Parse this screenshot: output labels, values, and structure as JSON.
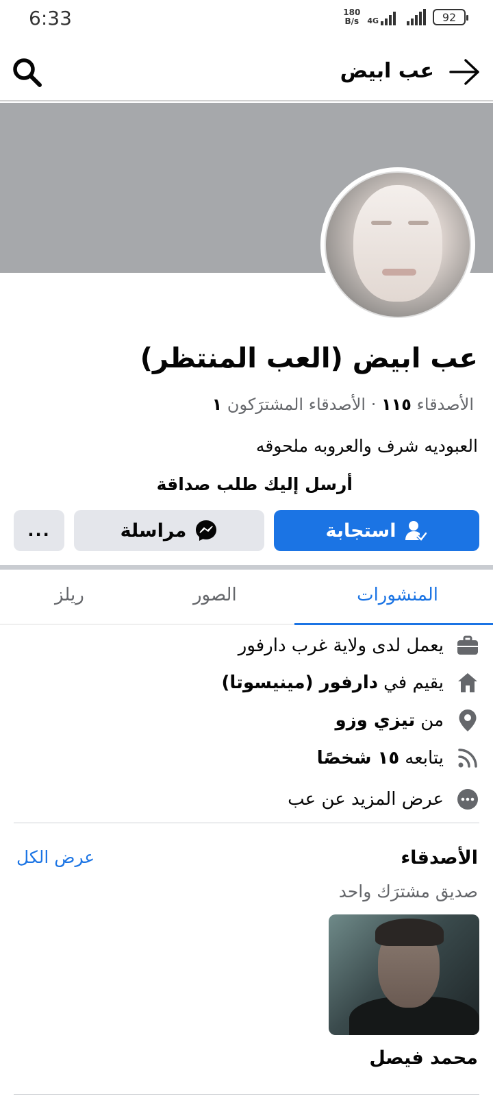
{
  "status_bar": {
    "time": "6:33",
    "net_speed_value": "180",
    "net_speed_unit": "B/s",
    "net_type": "4G",
    "battery": "92"
  },
  "header": {
    "title": "عب ابيض"
  },
  "profile": {
    "name": "عب ابيض (العب المنتظر)",
    "friends_label": "الأصدقاء",
    "friends_count": "١١٥",
    "mutual_label": "الأصدقاء المشترَكون",
    "mutual_count": "١",
    "bio": "العبوديه شرف والعروبه ملحوقه",
    "request_text": "أرسل إليك طلب صداقة"
  },
  "actions": {
    "respond": "استجابة",
    "message": "مراسلة",
    "more": "..."
  },
  "tabs": {
    "posts": "المنشورات",
    "photos": "الصور",
    "reels": "ريلز"
  },
  "details": {
    "work": "يعمل لدى ولاية غرب دارفور",
    "lives_prefix": "يقيم في",
    "lives_place": "دارفور (مينيسوتا)",
    "from_prefix": "من",
    "from_place": "تيزي وزو",
    "followed_prefix": "يتابعه",
    "followed_count": "١٥ شخصًا",
    "see_more": "عرض المزيد عن عب"
  },
  "friends_section": {
    "title": "الأصدقاء",
    "see_all": "عرض الكل",
    "mutual": "صديق مشترَك واحد",
    "friend_name": "محمد فيصل"
  },
  "colors": {
    "accent": "#1b74e4",
    "cover": "#a6a8ab",
    "secondary_button": "#e4e6eb",
    "secondary_text": "#65676b"
  }
}
